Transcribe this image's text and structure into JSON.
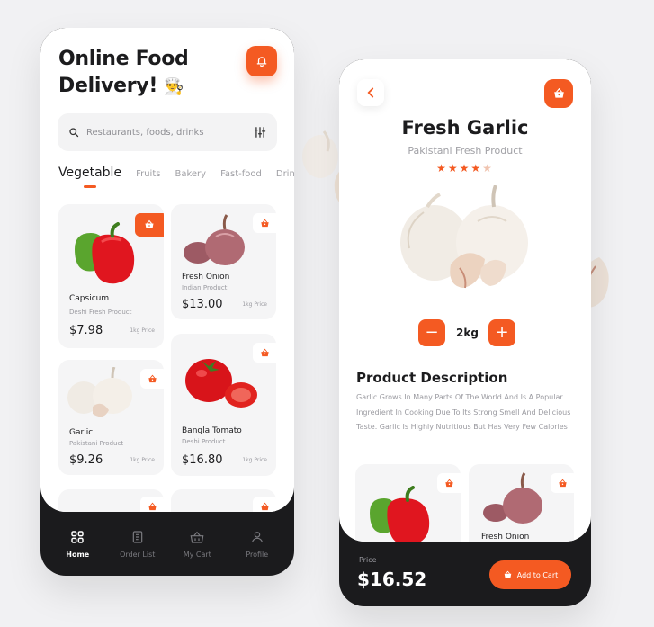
{
  "left": {
    "title_line1": "Online Food",
    "title_line2": "Delivery!",
    "search_placeholder": "Restaurants, foods, drinks",
    "tabs": [
      "Vegetable",
      "Fruits",
      "Bakery",
      "Fast-food",
      "Drinks"
    ],
    "active_tab": "Vegetable",
    "products": [
      {
        "name": "Capsicum",
        "subtitle": "Deshi Fresh Product",
        "price": "$7.98",
        "unit": "1kg Price"
      },
      {
        "name": "Fresh Onion",
        "subtitle": "Indian Product",
        "price": "$13.00",
        "unit": "1kg Price"
      },
      {
        "name": "Garlic",
        "subtitle": "Pakistani Product",
        "price": "$9.26",
        "unit": "1kg Price"
      },
      {
        "name": "Bangla Tomato",
        "subtitle": "Deshi Product",
        "price": "$16.80",
        "unit": "1kg Price"
      }
    ],
    "nav": [
      {
        "label": "Home",
        "icon": "grid-icon"
      },
      {
        "label": "Order List",
        "icon": "document-icon"
      },
      {
        "label": "My Cart",
        "icon": "basket-icon"
      },
      {
        "label": "Profile",
        "icon": "user-icon"
      }
    ]
  },
  "right": {
    "product_name": "Fresh Garlic",
    "product_subtitle": "Pakistani Fresh Product",
    "rating": 4,
    "rating_max": 5,
    "quantity": "2kg",
    "description_title": "Product Description",
    "description": "Garlic Grows In Many Parts Of The World And Is A Popular Ingredient In Cooking Due To Its Strong Smell And Delicious Taste. Garlic Is Highly Nutritious But Has Very Few Calories",
    "related": [
      {
        "name": "Fresh Onion"
      }
    ],
    "price_label": "Price",
    "price": "$16.52",
    "add_to_cart": "Add to Cart"
  },
  "colors": {
    "accent": "#f45a22",
    "dark": "#1b1b1d",
    "card": "#f5f5f6"
  }
}
